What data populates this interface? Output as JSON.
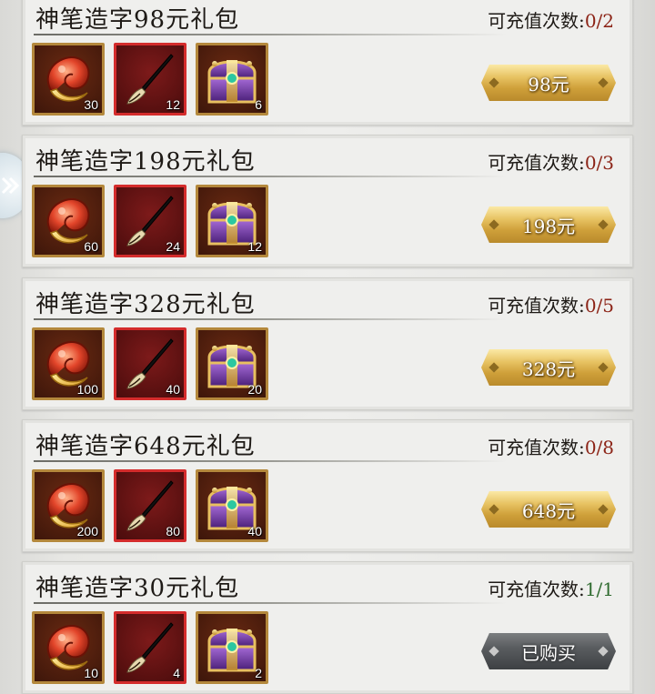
{
  "colors": {
    "card_bg": "#efefed",
    "count_red": "#8c2417",
    "count_green": "#2f6b2f",
    "gold": "#d9b14e",
    "item_frame": "#b4883c",
    "brush_frame": "#d42c2c"
  },
  "side_tab": {
    "icon": "double-chevron-right-icon"
  },
  "count_label": "可充值次数:",
  "packs": [
    {
      "title": "神笔造字98元礼包",
      "count": "0/2",
      "items": [
        {
          "icon": "red-jade-orb-icon",
          "qty": "30"
        },
        {
          "icon": "calligraphy-brush-icon",
          "qty": "12"
        },
        {
          "icon": "purple-treasure-chest-icon",
          "qty": "6"
        }
      ],
      "button": "98元",
      "bought": false
    },
    {
      "title": "神笔造字198元礼包",
      "count": "0/3",
      "items": [
        {
          "icon": "red-jade-orb-icon",
          "qty": "60"
        },
        {
          "icon": "calligraphy-brush-icon",
          "qty": "24"
        },
        {
          "icon": "purple-treasure-chest-icon",
          "qty": "12"
        }
      ],
      "button": "198元",
      "bought": false
    },
    {
      "title": "神笔造字328元礼包",
      "count": "0/5",
      "items": [
        {
          "icon": "red-jade-orb-icon",
          "qty": "100"
        },
        {
          "icon": "calligraphy-brush-icon",
          "qty": "40"
        },
        {
          "icon": "purple-treasure-chest-icon",
          "qty": "20"
        }
      ],
      "button": "328元",
      "bought": false
    },
    {
      "title": "神笔造字648元礼包",
      "count": "0/8",
      "items": [
        {
          "icon": "red-jade-orb-icon",
          "qty": "200"
        },
        {
          "icon": "calligraphy-brush-icon",
          "qty": "80"
        },
        {
          "icon": "purple-treasure-chest-icon",
          "qty": "40"
        }
      ],
      "button": "648元",
      "bought": false
    },
    {
      "title": "神笔造字30元礼包",
      "count": "1/1",
      "items": [
        {
          "icon": "red-jade-orb-icon",
          "qty": "10"
        },
        {
          "icon": "calligraphy-brush-icon",
          "qty": "4"
        },
        {
          "icon": "purple-treasure-chest-icon",
          "qty": "2"
        }
      ],
      "button": "已购买",
      "bought": true
    }
  ]
}
